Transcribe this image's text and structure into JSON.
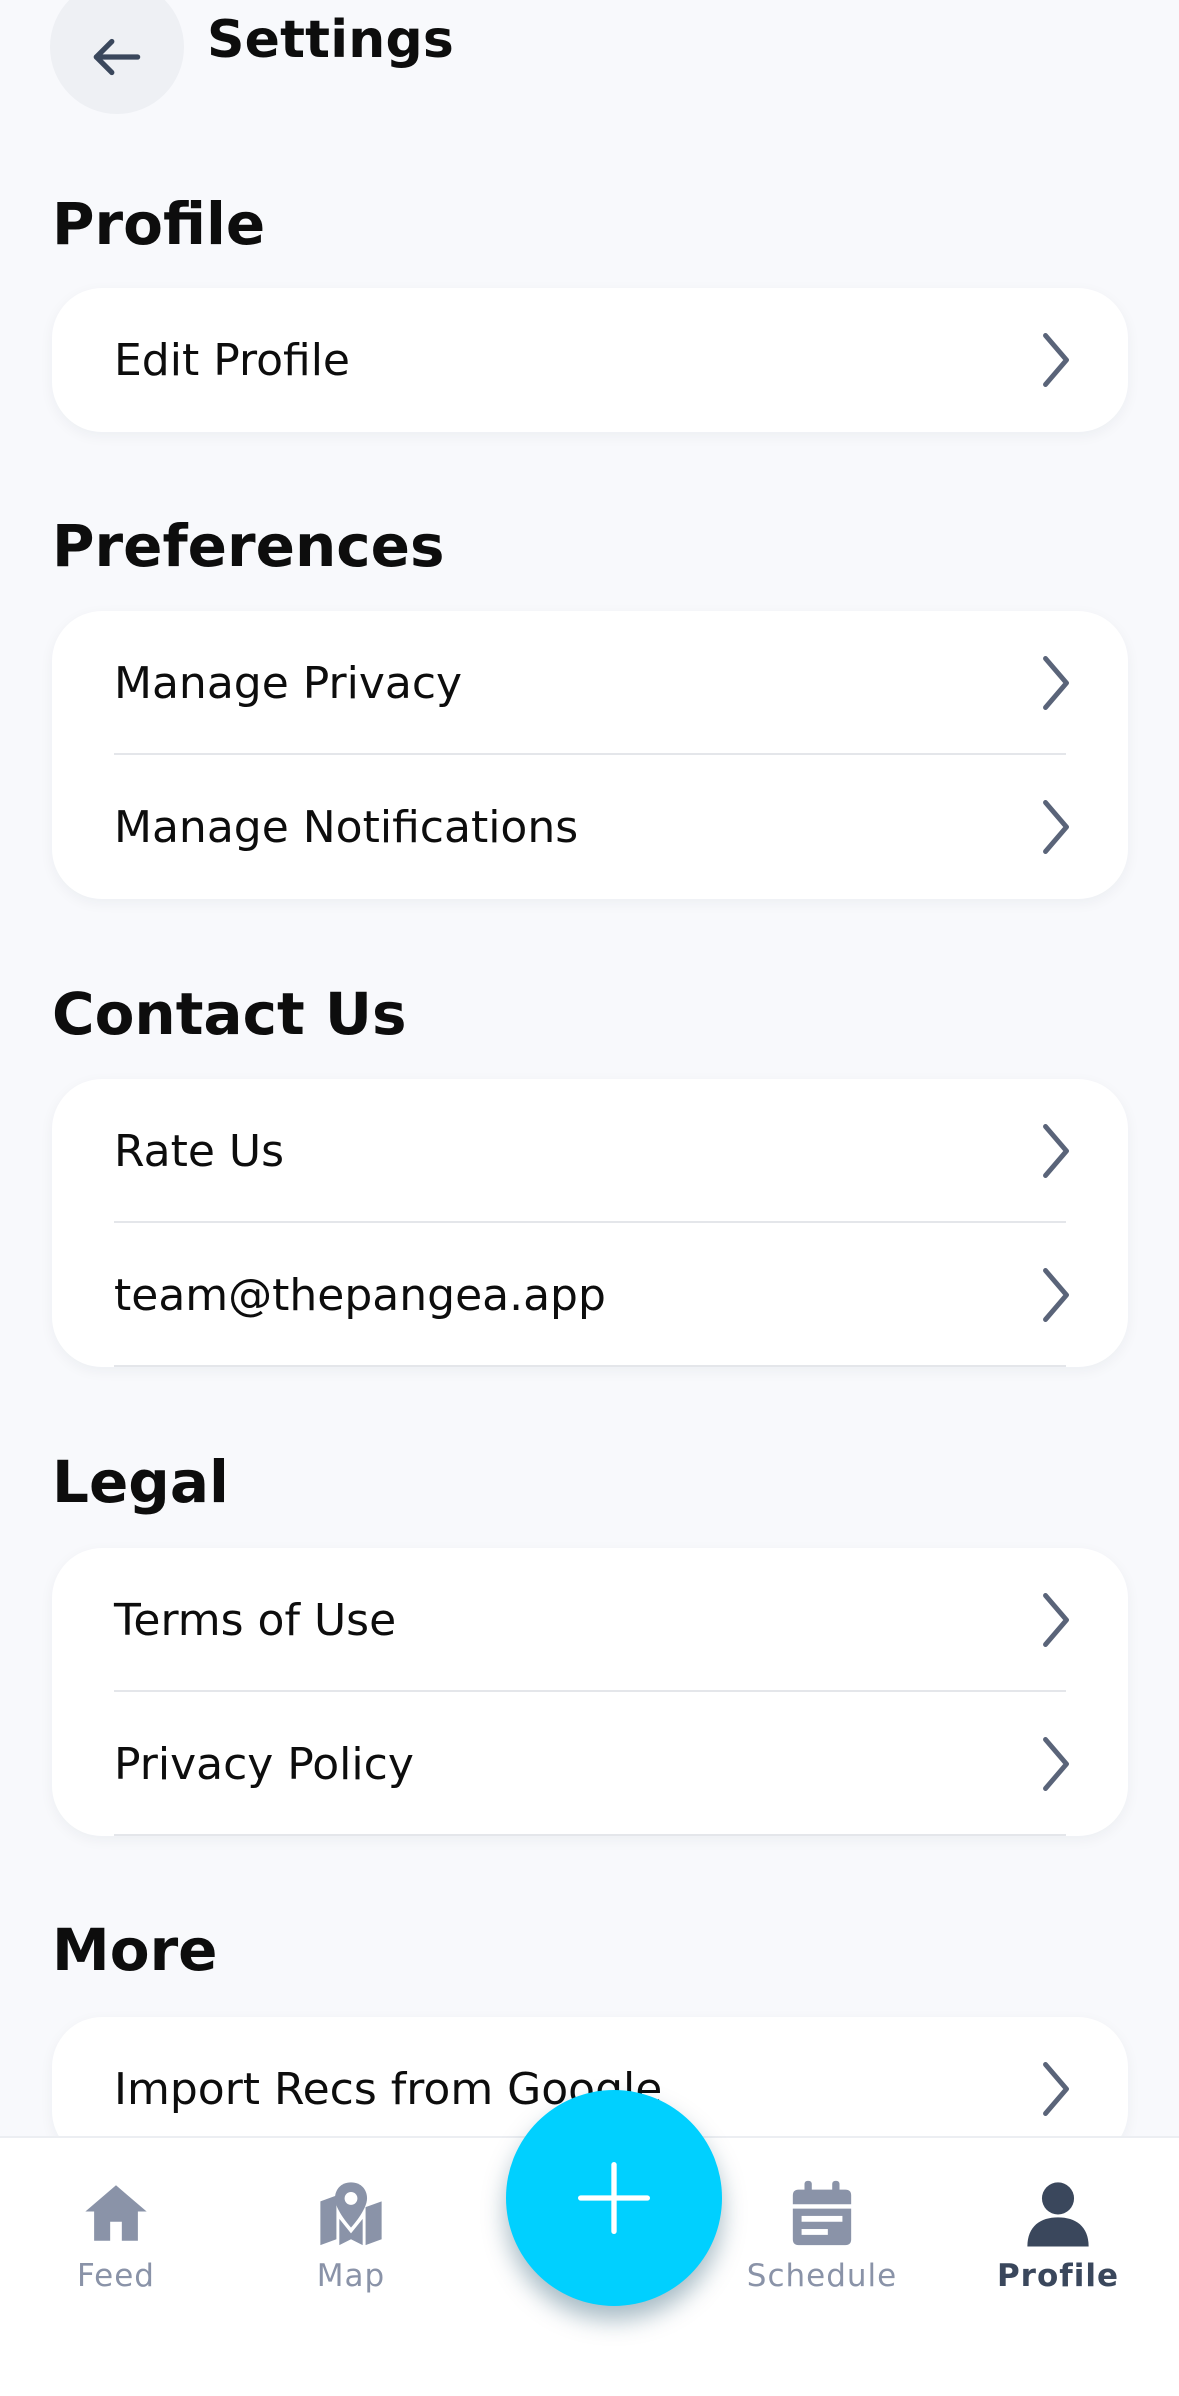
{
  "header": {
    "title": "Settings"
  },
  "sections": {
    "profile": {
      "title": "Profile",
      "items": [
        "Edit Profile"
      ]
    },
    "preferences": {
      "title": "Preferences",
      "items": [
        "Manage Privacy",
        "Manage Notifications"
      ]
    },
    "contact": {
      "title": "Contact Us",
      "items": [
        "Rate Us",
        "team@thepangea.app"
      ]
    },
    "legal": {
      "title": "Legal",
      "items": [
        "Terms of Use",
        "Privacy Policy"
      ]
    },
    "more": {
      "title": "More",
      "items": [
        "Import Recs from Google"
      ]
    }
  },
  "nav": {
    "feed": "Feed",
    "map": "Map",
    "schedule": "Schedule",
    "profile": "Profile",
    "active": "profile"
  },
  "colors": {
    "accent": "#00d0ff",
    "nav_inactive": "#8a93a8",
    "nav_active": "#3a475c",
    "chevron": "#5a6479",
    "background": "#f8f9fc"
  },
  "icons": {
    "back": "arrow-left-icon",
    "chevron": "chevron-right-icon",
    "feed": "home-icon",
    "map": "map-pin-icon",
    "add": "plus-icon",
    "schedule": "calendar-icon",
    "profile": "user-icon"
  }
}
